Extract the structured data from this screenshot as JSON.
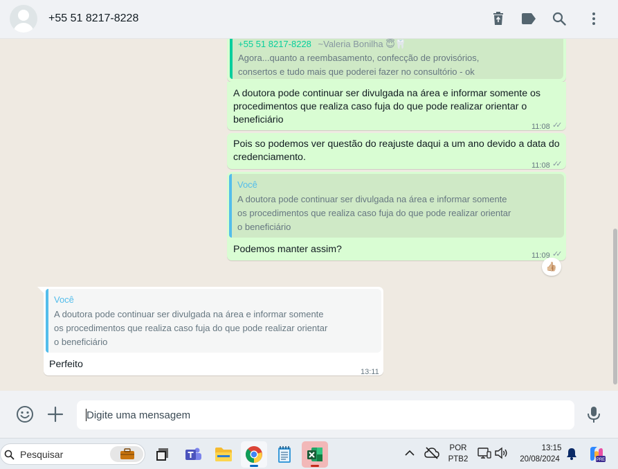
{
  "header": {
    "contact_name": "+55 51 8217-8228"
  },
  "messages": {
    "m1": {
      "quote_author": "+55 51 8217-8228",
      "quote_author_suffix": "~Valeria Bonilha 😇🦷",
      "quote_line1": "Agora...quanto a reembasamento, confecção de provisórios,",
      "quote_line2": "consertos e tudo mais que poderei fazer no consultório - ok"
    },
    "m2": {
      "line1": "A doutora pode continuar ser divulgada na área e informar somente os",
      "line2": "procedimentos que realiza caso fuja do que pode realizar orientar o",
      "line3": "beneficiário",
      "time": "11:08"
    },
    "m3": {
      "line1": "Pois so podemos ver questão do reajuste daqui a um ano devido a data do",
      "line2": "credenciamento.",
      "time": "11:08"
    },
    "m4": {
      "quote_author": "Você",
      "quote_line1": "A doutora pode continuar ser divulgada na área e informar somente",
      "quote_line2": "os procedimentos que realiza caso fuja do que pode realizar orientar",
      "quote_line3": "o beneficiário",
      "text": "Podemos manter assim?",
      "time": "11:09",
      "reaction": "👍🏼"
    },
    "m5": {
      "quote_author": "Você",
      "quote_line1": "A doutora pode continuar ser divulgada na área e informar somente",
      "quote_line2": "os procedimentos que realiza caso fuja do que pode realizar orientar",
      "quote_line3": "o beneficiário",
      "text": "Perfeito",
      "time": "13:11"
    }
  },
  "composer": {
    "placeholder": "Digite uma mensagem"
  },
  "taskbar": {
    "search_label": "Pesquisar",
    "lang_line1": "POR",
    "lang_line2": "PTB2",
    "clock_time": "13:15",
    "clock_date": "20/08/2024"
  },
  "colors": {
    "outgoing_bubble": "#d9fdd3",
    "incoming_bubble": "#ffffff",
    "quote_bar_self": "#53bdeb",
    "quote_bar_other": "#06cf9c",
    "chat_background": "#efeae2"
  }
}
